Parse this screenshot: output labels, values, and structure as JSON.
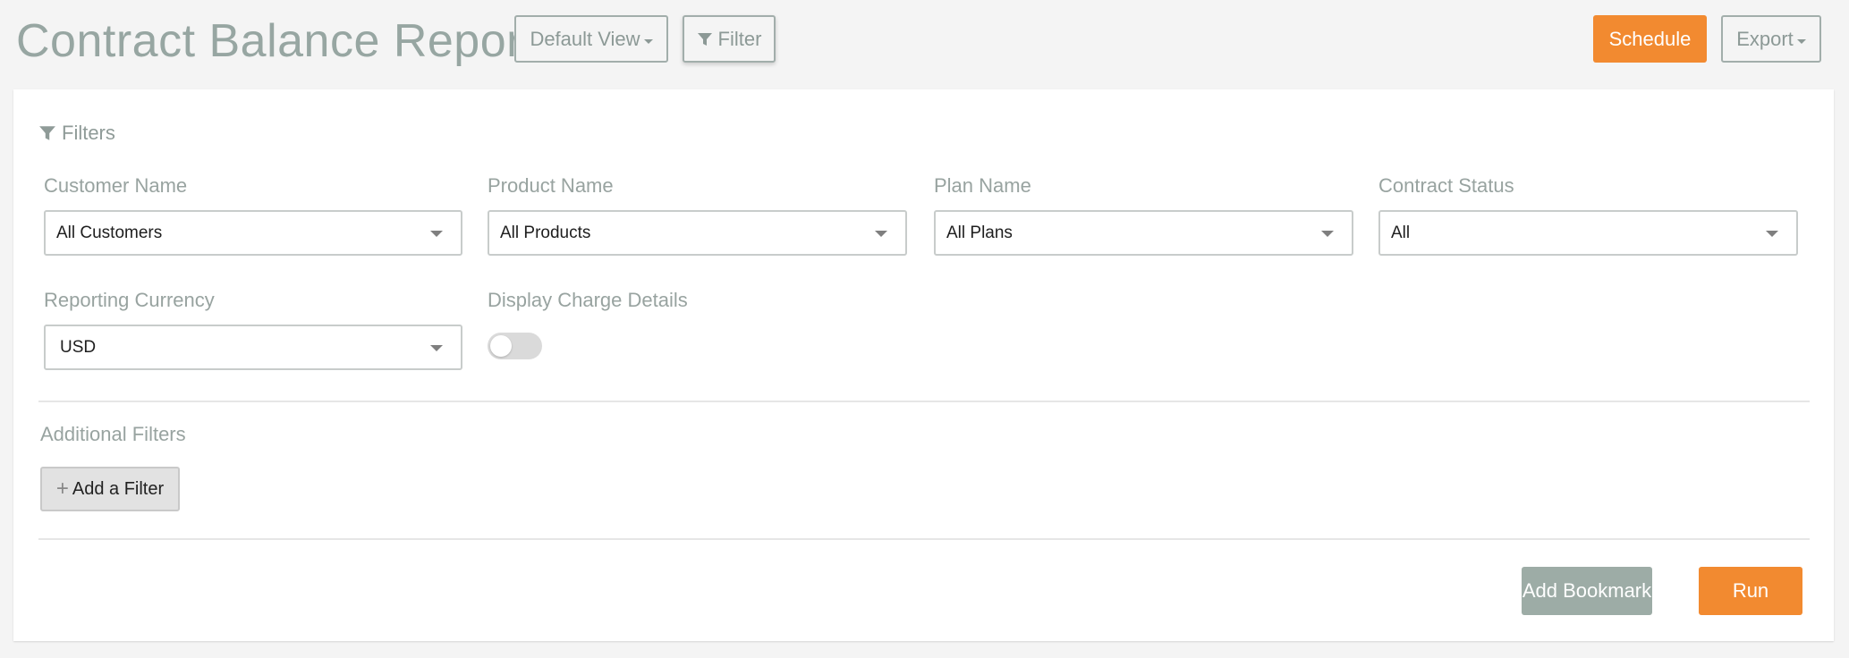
{
  "header": {
    "title": "Contract Balance Report",
    "default_view_label": "Default View",
    "filter_label": "Filter",
    "schedule_label": "Schedule",
    "export_label": "Export"
  },
  "filters": {
    "heading": "Filters",
    "fields": [
      {
        "label": "Customer Name",
        "value": "All Customers"
      },
      {
        "label": "Product Name",
        "value": "All Products"
      },
      {
        "label": "Plan Name",
        "value": "All Plans"
      },
      {
        "label": "Contract Status",
        "value": "All"
      },
      {
        "label": "Reporting Currency",
        "value": "USD"
      }
    ],
    "charge_details": {
      "label": "Display Charge Details",
      "enabled": false
    }
  },
  "additional": {
    "heading": "Additional Filters",
    "add_label": "Add a Filter"
  },
  "actions": {
    "bookmark_label": "Add Bookmark",
    "run_label": "Run"
  },
  "colors": {
    "accent": "#f28a30",
    "secondary": "#9daca6",
    "title": "#97a6a2"
  }
}
